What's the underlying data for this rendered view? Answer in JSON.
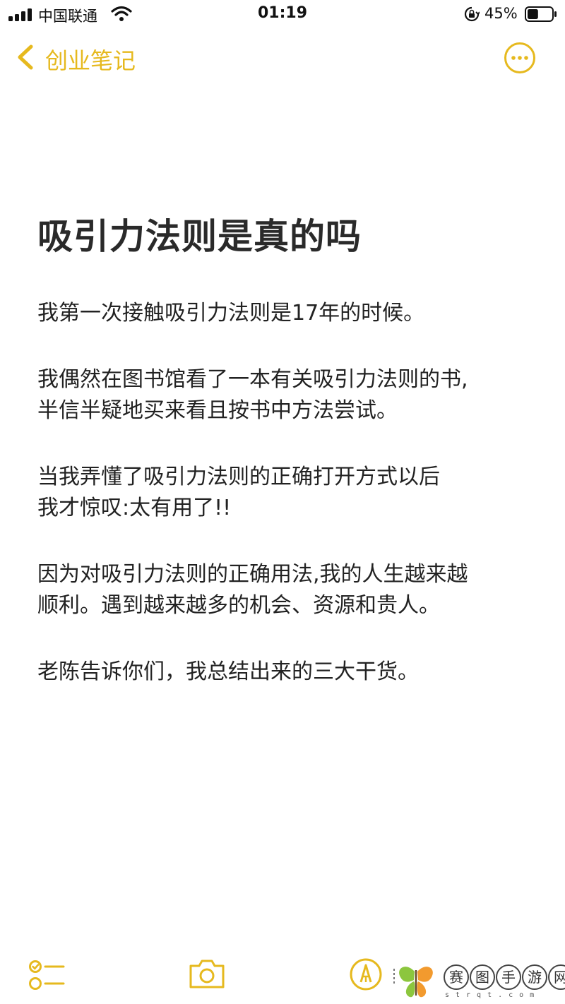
{
  "status_bar": {
    "carrier": "中国联通",
    "time": "01:19",
    "battery_percent": "45%",
    "battery_level": 0.45,
    "icons": [
      "signal-icon",
      "wifi-icon",
      "orientation-lock-icon",
      "battery-icon"
    ]
  },
  "nav": {
    "back_label": "创业笔记",
    "back_icon": "chevron-left-icon",
    "more_icon": "more-ellipsis-icon"
  },
  "note": {
    "title": "吸引力法则是真的吗",
    "paragraphs": [
      [
        "我第一次接触吸引力法则是17年的时候。"
      ],
      [
        "我偶然在图书馆看了一本有关吸引力法则的书,",
        "半信半疑地买来看且按书中方法尝试。"
      ],
      [
        "当我弄懂了吸引力法则的正确打开方式以后",
        "我才惊叹:太有用了!!"
      ],
      [
        "因为对吸引力法则的正确用法,我的人生越来越",
        "顺利。遇到越来越多的机会、资源和贵人。"
      ],
      [
        "老陈告诉你们，我总结出来的三大干货。"
      ]
    ]
  },
  "toolbar": {
    "icons": [
      "checklist-icon",
      "camera-icon",
      "markup-pen-icon"
    ]
  },
  "watermark": {
    "chars": [
      "赛",
      "图",
      "手",
      "游",
      "网"
    ],
    "sub": "strqt.com"
  },
  "colors": {
    "accent": "#e6b91e",
    "text": "#222222",
    "background": "#ffffff"
  }
}
